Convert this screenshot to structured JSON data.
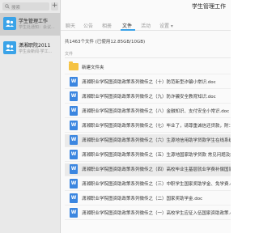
{
  "sidebar": {
    "search": {
      "placeholder": "搜索"
    },
    "add_label": "+",
    "chats": [
      {
        "name": "学生管理工作",
        "last": "学生处通知：会议..."
      },
      {
        "name": "潇湘职院2011",
        "last": "学生会新闻·学工..."
      }
    ]
  },
  "main": {
    "title": "学生管理工作",
    "tabs": [
      {
        "label": "聊天"
      },
      {
        "label": "公告"
      },
      {
        "label": "相册"
      },
      {
        "label": "文件"
      },
      {
        "label": "活动"
      },
      {
        "label": "设置 ▾"
      }
    ],
    "summary": "共1463个文件 (已使用12.85GB/10GB)",
    "list_header": "文件",
    "folder": {
      "name": "新建文件夹"
    },
    "files": [
      "潇湘职业学院图资助政策系列微传之（十）防范新型诈骗小常识.doc",
      "潇湘职业学院图资助政策系列微传之（九）防诈骗安全教育知识.doc",
      "潇湘职业学院图资助政策系列微传之（八）金融知识、支付安全小常识.doc",
      "潇湘职业学院图资助政策系列微传之（七）毕业了，请尊重诚信还贷款，附：国家助学贷款还款...",
      "潇湘职业学院图资助政策系列微传之（六）生源地信用助学贷款学生在线系统办理流程...",
      "潇湘职业学院图资助政策系列微传之（五）生源地国家助学贷款 常见问题及解答.doc",
      "潇湘职业学院图资助政策系列微传之（四）高校毕业生基层就业学费补偿国家助学贷款代偿...",
      "潇湘职业学院图资助政策系列微传之（三）中职学生国家奖助学金、免学费.doc",
      "潇湘职业学院图资助政策系列微传之（二）国家奖助学金.doc",
      "潇湘职业学院图资助政策系列微传之（一）高校学生应征入伍国家资助政策.doc"
    ],
    "file_icon_letter": "W"
  }
}
